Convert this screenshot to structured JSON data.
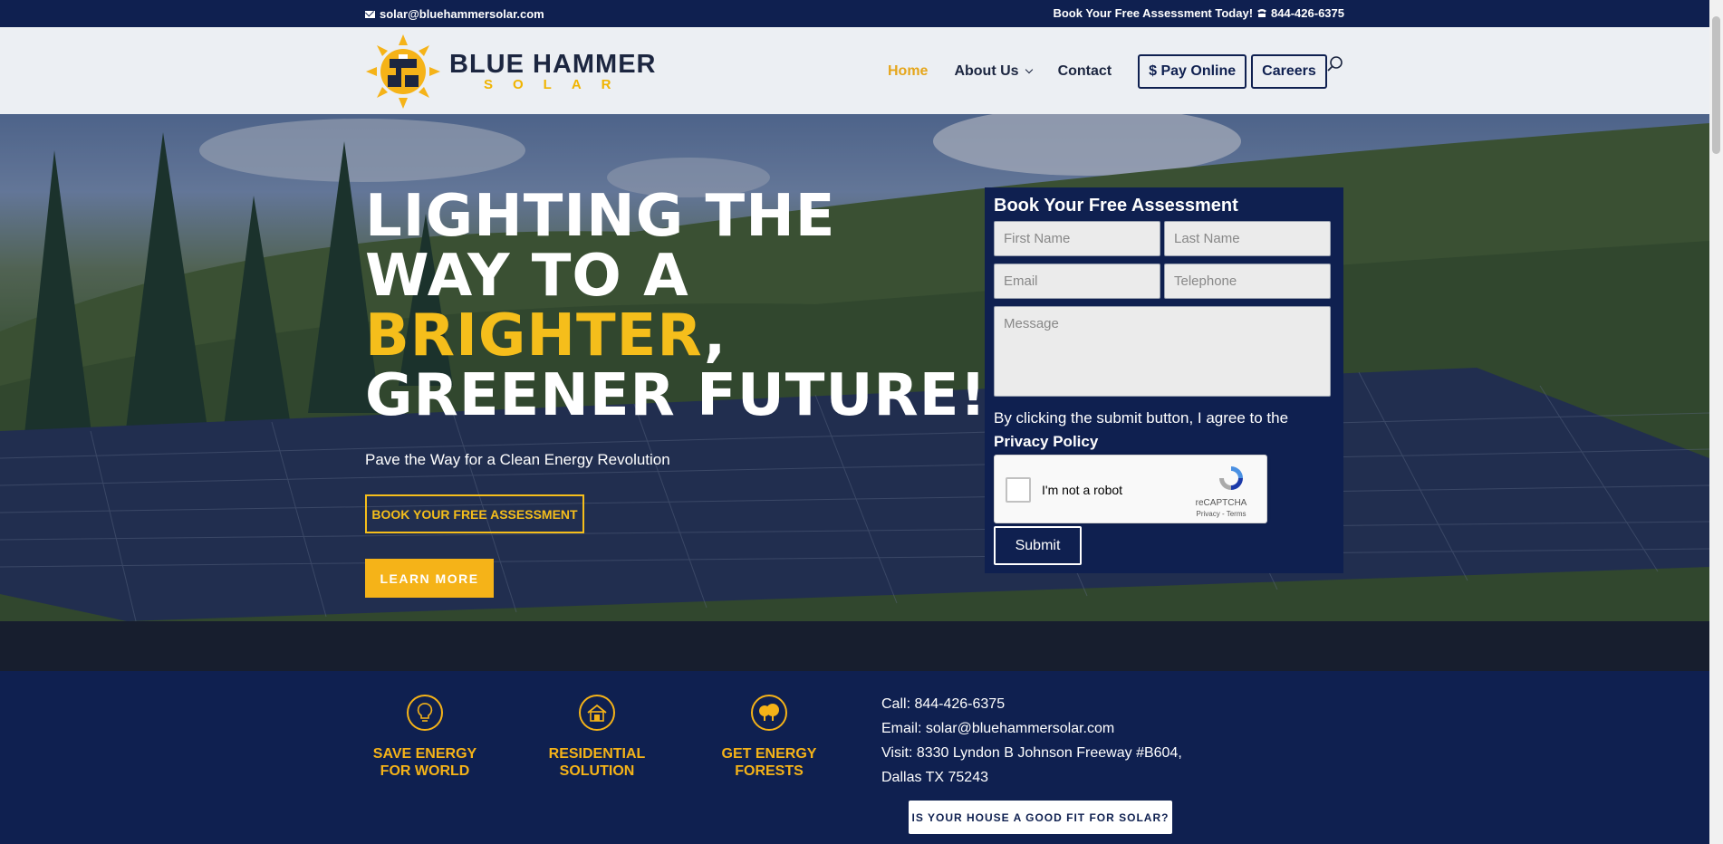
{
  "topbar": {
    "email": "solar@bluehammersolar.com",
    "cta": "Book Your Free Assessment Today!",
    "phone": "844-426-6375"
  },
  "logo": {
    "brand": "BLUE HAMMER",
    "sub": "SOLAR"
  },
  "nav": {
    "items": [
      "Home",
      "About Us",
      "Contact"
    ],
    "pay": "$ Pay Online",
    "careers": "Careers"
  },
  "hero": {
    "line1": "LIGHTING THE",
    "line2": "WAY TO A",
    "line3_highlight": "BRIGHTER",
    "line3_rest": ",",
    "line4": "GREENER FUTURE!",
    "tagline": "Pave the Way for a Clean Energy Revolution",
    "btn_outline": "BOOK YOUR FREE ASSESSMENT",
    "btn_fill": "LEARN MORE"
  },
  "form": {
    "title": "Book Your Free Assessment",
    "first_name": "First Name",
    "last_name": "Last Name",
    "email": "Email",
    "telephone": "Telephone",
    "message": "Message",
    "agree": "By clicking the submit button, I agree to the",
    "privacy": "Privacy Policy",
    "captcha_label": "I'm not a robot",
    "captcha_brand": "reCAPTCHA",
    "captcha_links": "Privacy - Terms",
    "submit": "Submit"
  },
  "features": [
    {
      "line1": "SAVE ENERGY",
      "line2": "FOR WORLD",
      "icon": "lightbulb-icon"
    },
    {
      "line1": "RESIDENTIAL",
      "line2": "SOLUTION",
      "icon": "house-icon"
    },
    {
      "line1": "GET ENERGY",
      "line2": "FORESTS",
      "icon": "tree-icon"
    }
  ],
  "contact": {
    "call": "Call: 844-426-6375",
    "email": "Email: solar@bluehammersolar.com",
    "visit1": "Visit: 8330 Lyndon B Johnson Freeway #B604,",
    "visit2": "Dallas TX 75243"
  },
  "fit_button": "IS YOUR HOUSE A GOOD FIT FOR SOLAR?",
  "colors": {
    "navy": "#0f2050",
    "gold": "#f5b318",
    "nav_active": "#e5a61c"
  }
}
